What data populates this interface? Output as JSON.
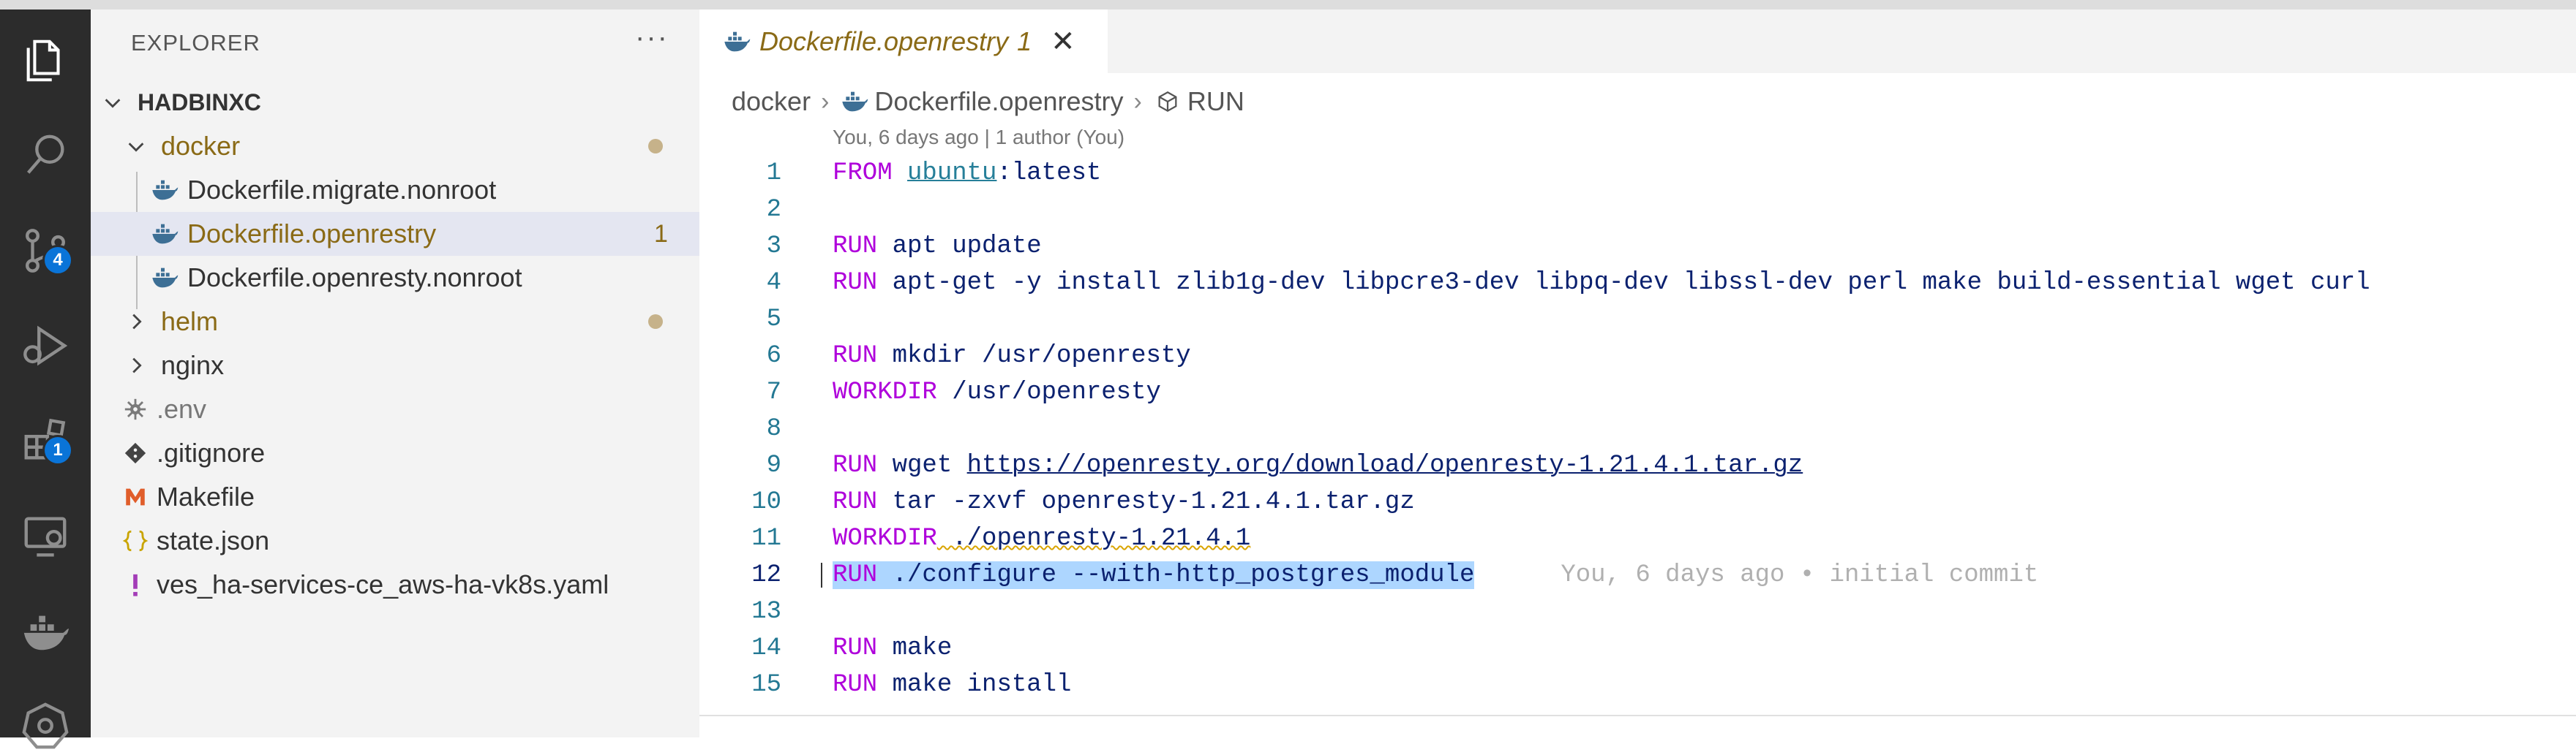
{
  "sidebar": {
    "title": "EXPLORER",
    "more_actions": "···",
    "root_folder": "HADBINXC",
    "items": [
      {
        "label": "docker",
        "count": ""
      },
      {
        "label": "Dockerfile.migrate.nonroot",
        "count": ""
      },
      {
        "label": "Dockerfile.openrestry",
        "count": "1"
      },
      {
        "label": "Dockerfile.openresty.nonroot",
        "count": ""
      },
      {
        "label": "helm",
        "count": ""
      },
      {
        "label": "nginx",
        "count": ""
      },
      {
        "label": ".env",
        "count": ""
      },
      {
        "label": ".gitignore",
        "count": ""
      },
      {
        "label": "Makefile",
        "count": ""
      },
      {
        "label": "state.json",
        "count": ""
      },
      {
        "label": "ves_ha-services-ce_aws-ha-vk8s.yaml",
        "count": ""
      }
    ]
  },
  "activity_bar": {
    "source_control_badge": "4",
    "extensions_badge": "1"
  },
  "editor": {
    "tab": {
      "title": "Dockerfile.openrestry",
      "problems": "1",
      "close_glyph": "✕"
    },
    "breadcrumb": [
      "docker",
      "Dockerfile.openrestry",
      "RUN"
    ],
    "blame_header": "You, 6 days ago | 1 author (You)",
    "inline_blame": "You, 6 days ago • initial commit",
    "lines": [
      {
        "n": "1",
        "kw": "FROM",
        "rest": " :latest",
        "link": "ubuntu"
      },
      {
        "n": "2",
        "kw": "",
        "rest": ""
      },
      {
        "n": "3",
        "kw": "RUN",
        "rest": " apt update"
      },
      {
        "n": "4",
        "kw": "RUN",
        "rest": " apt-get -y install zlib1g-dev libpcre3-dev libpq-dev libssl-dev perl make build-essential wget curl"
      },
      {
        "n": "5",
        "kw": "",
        "rest": ""
      },
      {
        "n": "6",
        "kw": "RUN",
        "rest": " mkdir /usr/openresty"
      },
      {
        "n": "7",
        "kw": "WORKDIR",
        "rest": " /usr/openresty"
      },
      {
        "n": "8",
        "kw": "",
        "rest": ""
      },
      {
        "n": "9",
        "kw": "RUN",
        "rest": " wget ",
        "link": "https://openresty.org/download/openresty-1.21.4.1.tar.gz"
      },
      {
        "n": "10",
        "kw": "RUN",
        "rest": " tar -zxvf openresty-1.21.4.1.tar.gz"
      },
      {
        "n": "11",
        "kw": "WORKDIR",
        "rest": " ./openresty-1.21.4.1"
      },
      {
        "n": "12",
        "kw": "RUN",
        "rest": " ./configure --with-http_postgres_module"
      },
      {
        "n": "13",
        "kw": "",
        "rest": ""
      },
      {
        "n": "14",
        "kw": "RUN",
        "rest": " make"
      },
      {
        "n": "15",
        "kw": "RUN",
        "rest": " make install"
      }
    ]
  },
  "colors": {
    "keyword": "#af00db",
    "modified_folder": "#8a6a16",
    "selection": "#add6ff",
    "badge": "#0a74d8"
  }
}
